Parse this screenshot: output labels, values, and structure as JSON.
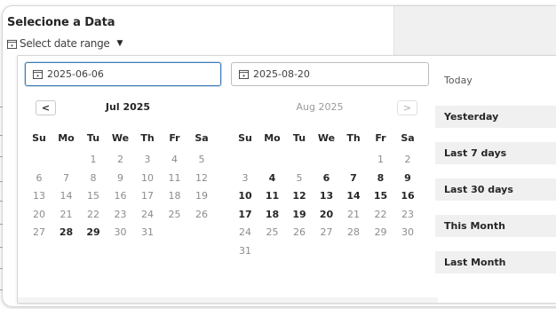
{
  "header": {
    "title": "Selecione a Data",
    "trigger_label": "Select date range"
  },
  "inputs": {
    "start": "2025-06-06",
    "end": "2025-08-20"
  },
  "calendars": [
    {
      "title": "Jul 2025",
      "dow": [
        "Su",
        "Mo",
        "Tu",
        "We",
        "Th",
        "Fr",
        "Sa"
      ],
      "weeks": [
        [
          "",
          "",
          "1",
          "2",
          "3",
          "4",
          "5"
        ],
        [
          "6",
          "7",
          "8",
          "9",
          "10",
          "11",
          "12"
        ],
        [
          "13",
          "14",
          "15",
          "16",
          "17",
          "18",
          "19"
        ],
        [
          "20",
          "21",
          "22",
          "23",
          "24",
          "25",
          "26"
        ],
        [
          "27",
          "28",
          "29",
          "30",
          "31",
          "",
          ""
        ]
      ],
      "bold_days": [
        "28",
        "29"
      ]
    },
    {
      "title": "Aug 2025",
      "dow": [
        "Su",
        "Mo",
        "Tu",
        "We",
        "Th",
        "Fr",
        "Sa"
      ],
      "weeks": [
        [
          "",
          "",
          "",
          "",
          "",
          "1",
          "2"
        ],
        [
          "3",
          "4",
          "5",
          "6",
          "7",
          "8",
          "9"
        ],
        [
          "10",
          "11",
          "12",
          "13",
          "14",
          "15",
          "16"
        ],
        [
          "17",
          "18",
          "19",
          "20",
          "21",
          "22",
          "23"
        ],
        [
          "24",
          "25",
          "26",
          "27",
          "28",
          "29",
          "30"
        ],
        [
          "31",
          "",
          "",
          "",
          "",
          "",
          ""
        ]
      ],
      "bold_days": [
        "4",
        "6",
        "7",
        "8",
        "9",
        "10",
        "11",
        "12",
        "13",
        "14",
        "15",
        "16",
        "17",
        "18",
        "19",
        "20"
      ]
    }
  ],
  "nav": {
    "prev": "<",
    "next": ">"
  },
  "presets": [
    "Today",
    "Yesterday",
    "Last 7 days",
    "Last 30 days",
    "This Month",
    "Last Month"
  ],
  "colors": {
    "accent_border": "#3b7ab4",
    "preset_bg": "#f0f0f0"
  }
}
